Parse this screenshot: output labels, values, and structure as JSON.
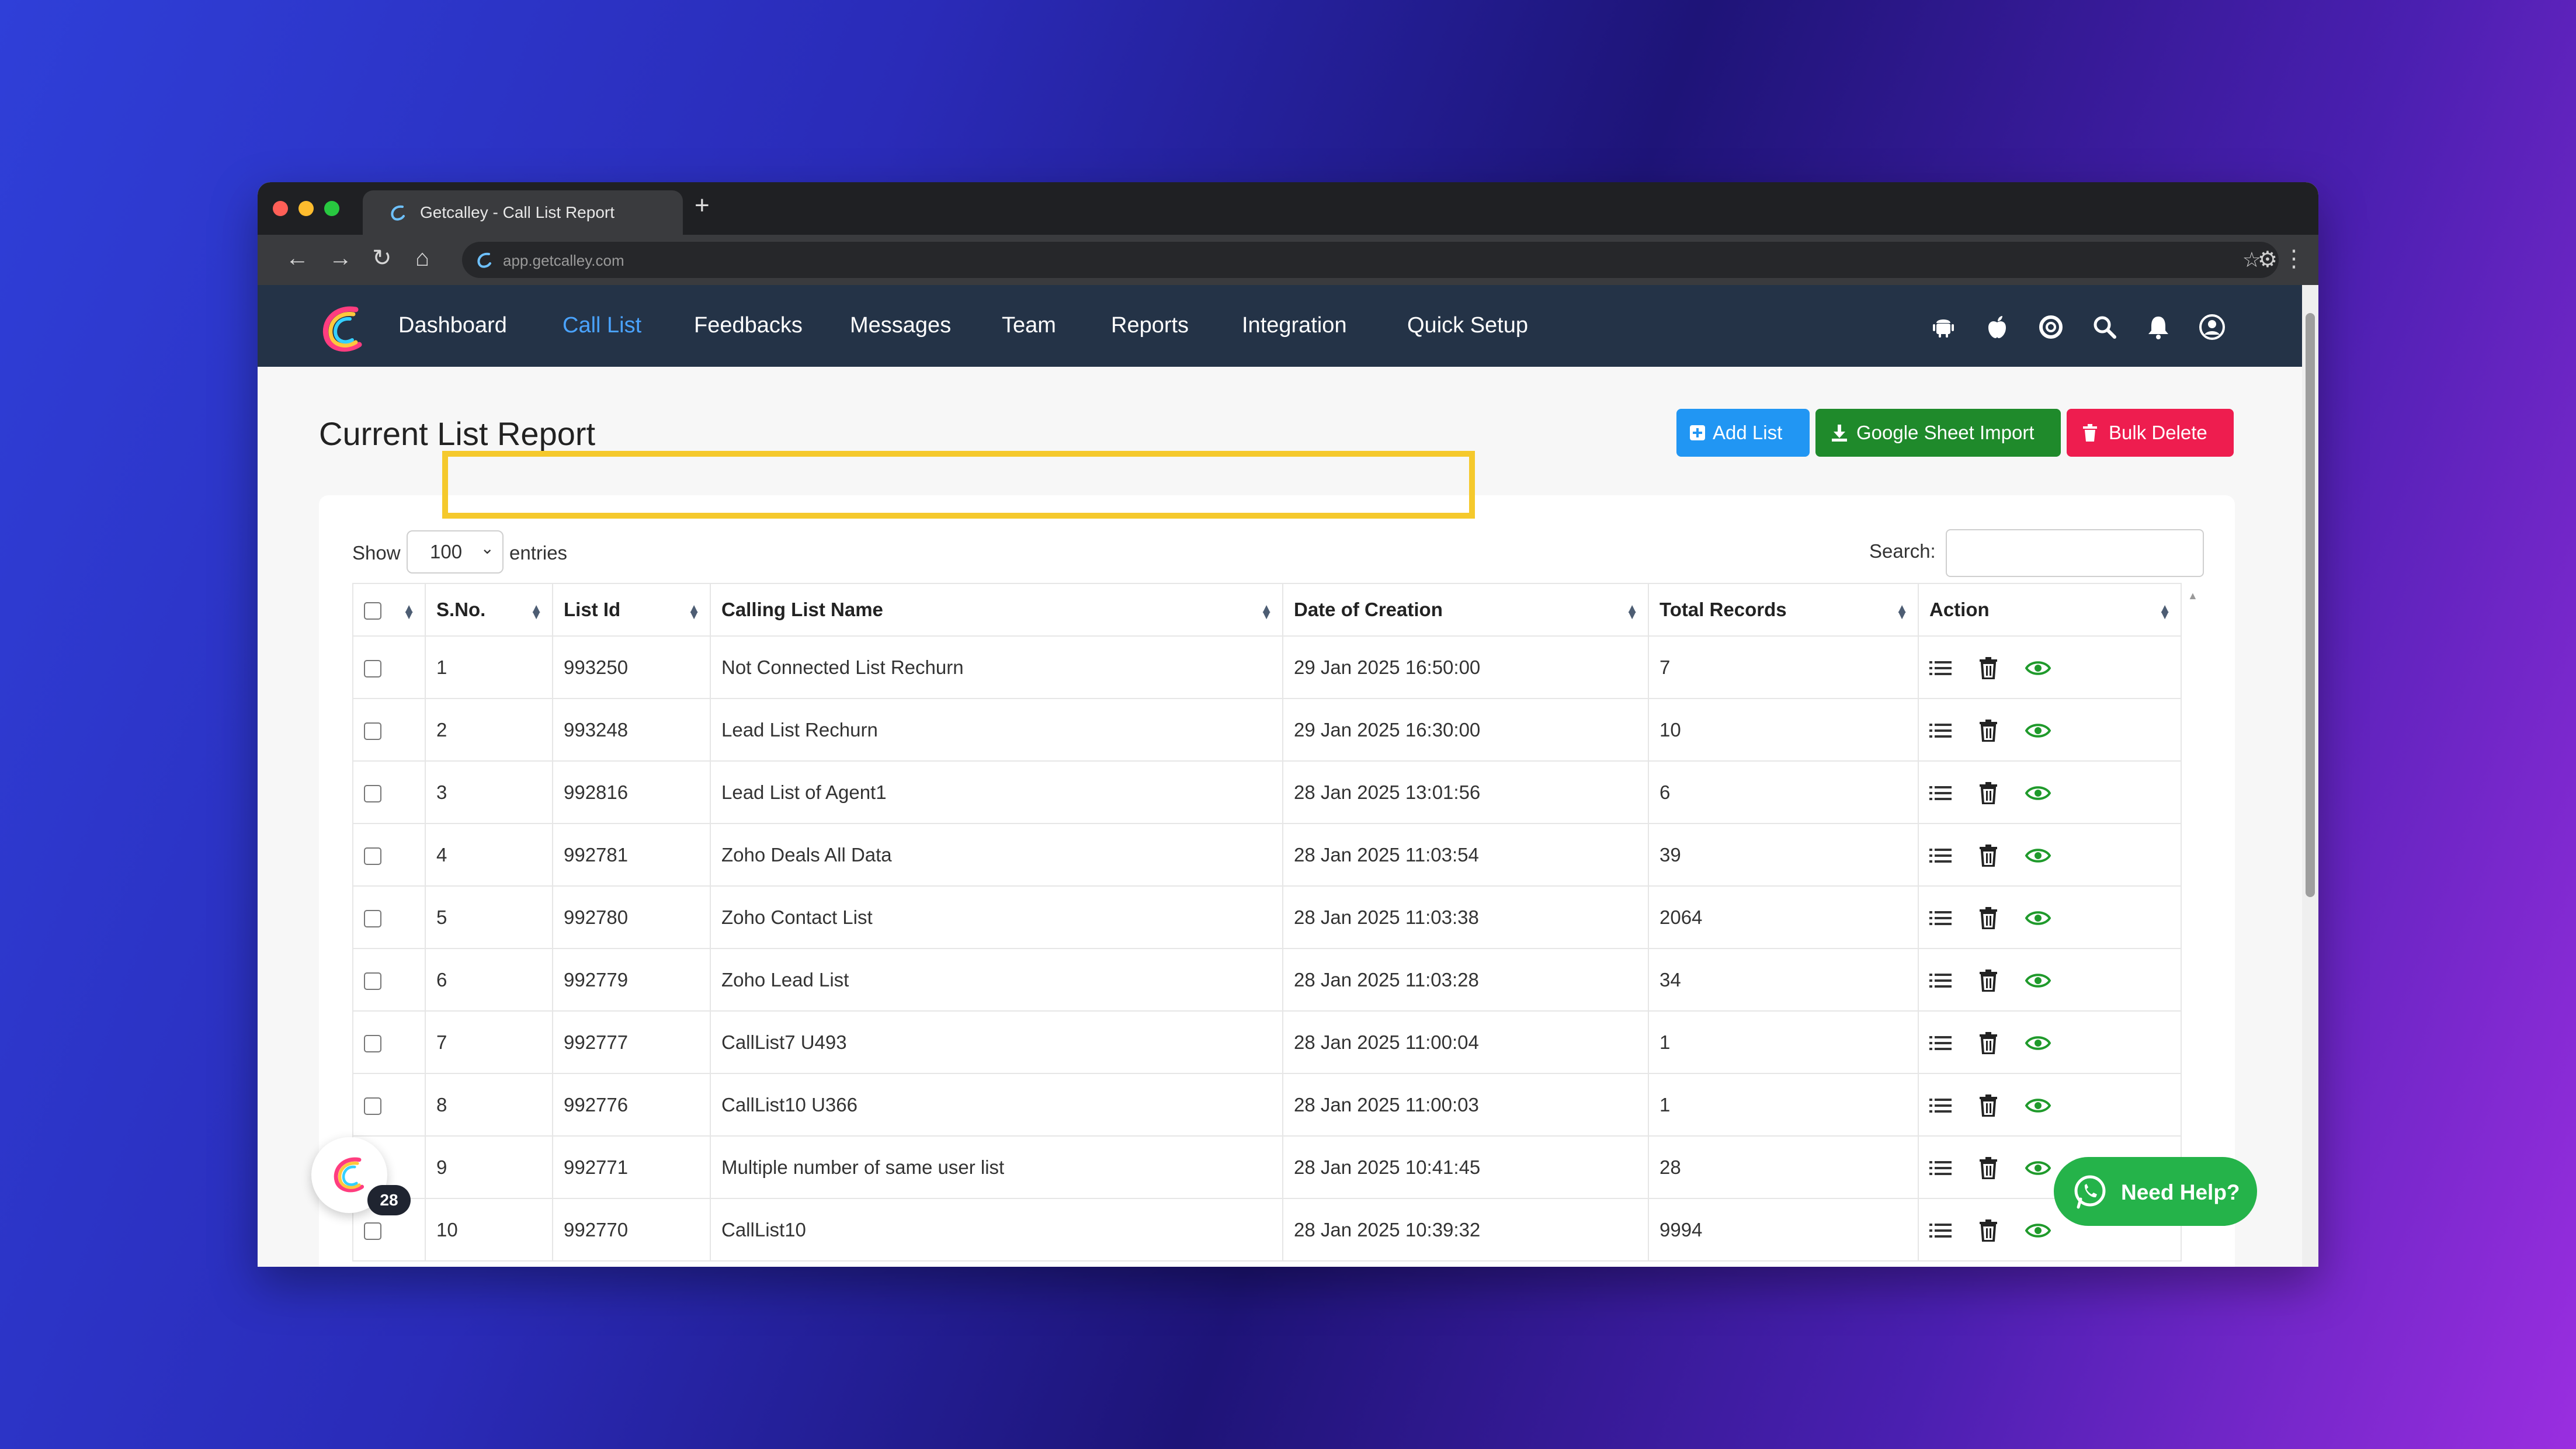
{
  "browser": {
    "tab_title": "Getcalley - Call List Report",
    "new_tab": "+",
    "url": "app.getcalley.com"
  },
  "nav": {
    "links": [
      "Dashboard",
      "Call List",
      "Feedbacks",
      "Messages",
      "Team",
      "Reports",
      "Integration",
      "Quick Setup"
    ],
    "active": "Call List",
    "icons": [
      "android-icon",
      "apple-icon",
      "support-icon",
      "search-icon",
      "bell-icon",
      "user-icon"
    ]
  },
  "page": {
    "title": "Current List Report",
    "buttons": {
      "add_list": "Add List",
      "google_sheet_import": "Google Sheet Import",
      "bulk_delete": "Bulk Delete"
    }
  },
  "table_controls": {
    "show_label": "Show",
    "entries_value": "100",
    "entries_label": "entries",
    "search_label": "Search:",
    "search_value": ""
  },
  "table": {
    "columns": [
      "S.No.",
      "List Id",
      "Calling List Name",
      "Date of Creation",
      "Total Records",
      "Action"
    ],
    "rows": [
      {
        "sno": "1",
        "list_id": "993250",
        "name": "Not Connected List Rechurn",
        "date": "29 Jan 2025 16:50:00",
        "total": "7"
      },
      {
        "sno": "2",
        "list_id": "993248",
        "name": "Lead List Rechurn",
        "date": "29 Jan 2025 16:30:00",
        "total": "10"
      },
      {
        "sno": "3",
        "list_id": "992816",
        "name": "Lead List of Agent1",
        "date": "28 Jan 2025 13:01:56",
        "total": "6"
      },
      {
        "sno": "4",
        "list_id": "992781",
        "name": "Zoho Deals All Data",
        "date": "28 Jan 2025 11:03:54",
        "total": "39"
      },
      {
        "sno": "5",
        "list_id": "992780",
        "name": "Zoho Contact List",
        "date": "28 Jan 2025 11:03:38",
        "total": "2064"
      },
      {
        "sno": "6",
        "list_id": "992779",
        "name": "Zoho Lead List",
        "date": "28 Jan 2025 11:03:28",
        "total": "34"
      },
      {
        "sno": "7",
        "list_id": "992777",
        "name": "CallList7 U493",
        "date": "28 Jan 2025 11:00:04",
        "total": "1"
      },
      {
        "sno": "8",
        "list_id": "992776",
        "name": "CallList10 U366",
        "date": "28 Jan 2025 11:00:03",
        "total": "1"
      },
      {
        "sno": "9",
        "list_id": "992771",
        "name": "Multiple number of same user list",
        "date": "28 Jan 2025 10:41:45",
        "total": "28"
      },
      {
        "sno": "10",
        "list_id": "992770",
        "name": "CallList10",
        "date": "28 Jan 2025 10:39:32",
        "total": "9994"
      }
    ],
    "action_icons": [
      "list-icon",
      "trash-icon",
      "eye-icon"
    ]
  },
  "floating": {
    "badge_count": "28",
    "need_help": "Need Help?"
  },
  "colors": {
    "nav_bg": "#243347",
    "nav_active": "#4aa3ff",
    "add_btn": "#2196f3",
    "gsheet_btn": "#1f8a2b",
    "bulk_btn": "#ee1d4f",
    "list_name": "#e02424",
    "eye_icon": "#1f9a2b",
    "highlight": "#f5c92c",
    "need_help": "#25b34a"
  }
}
